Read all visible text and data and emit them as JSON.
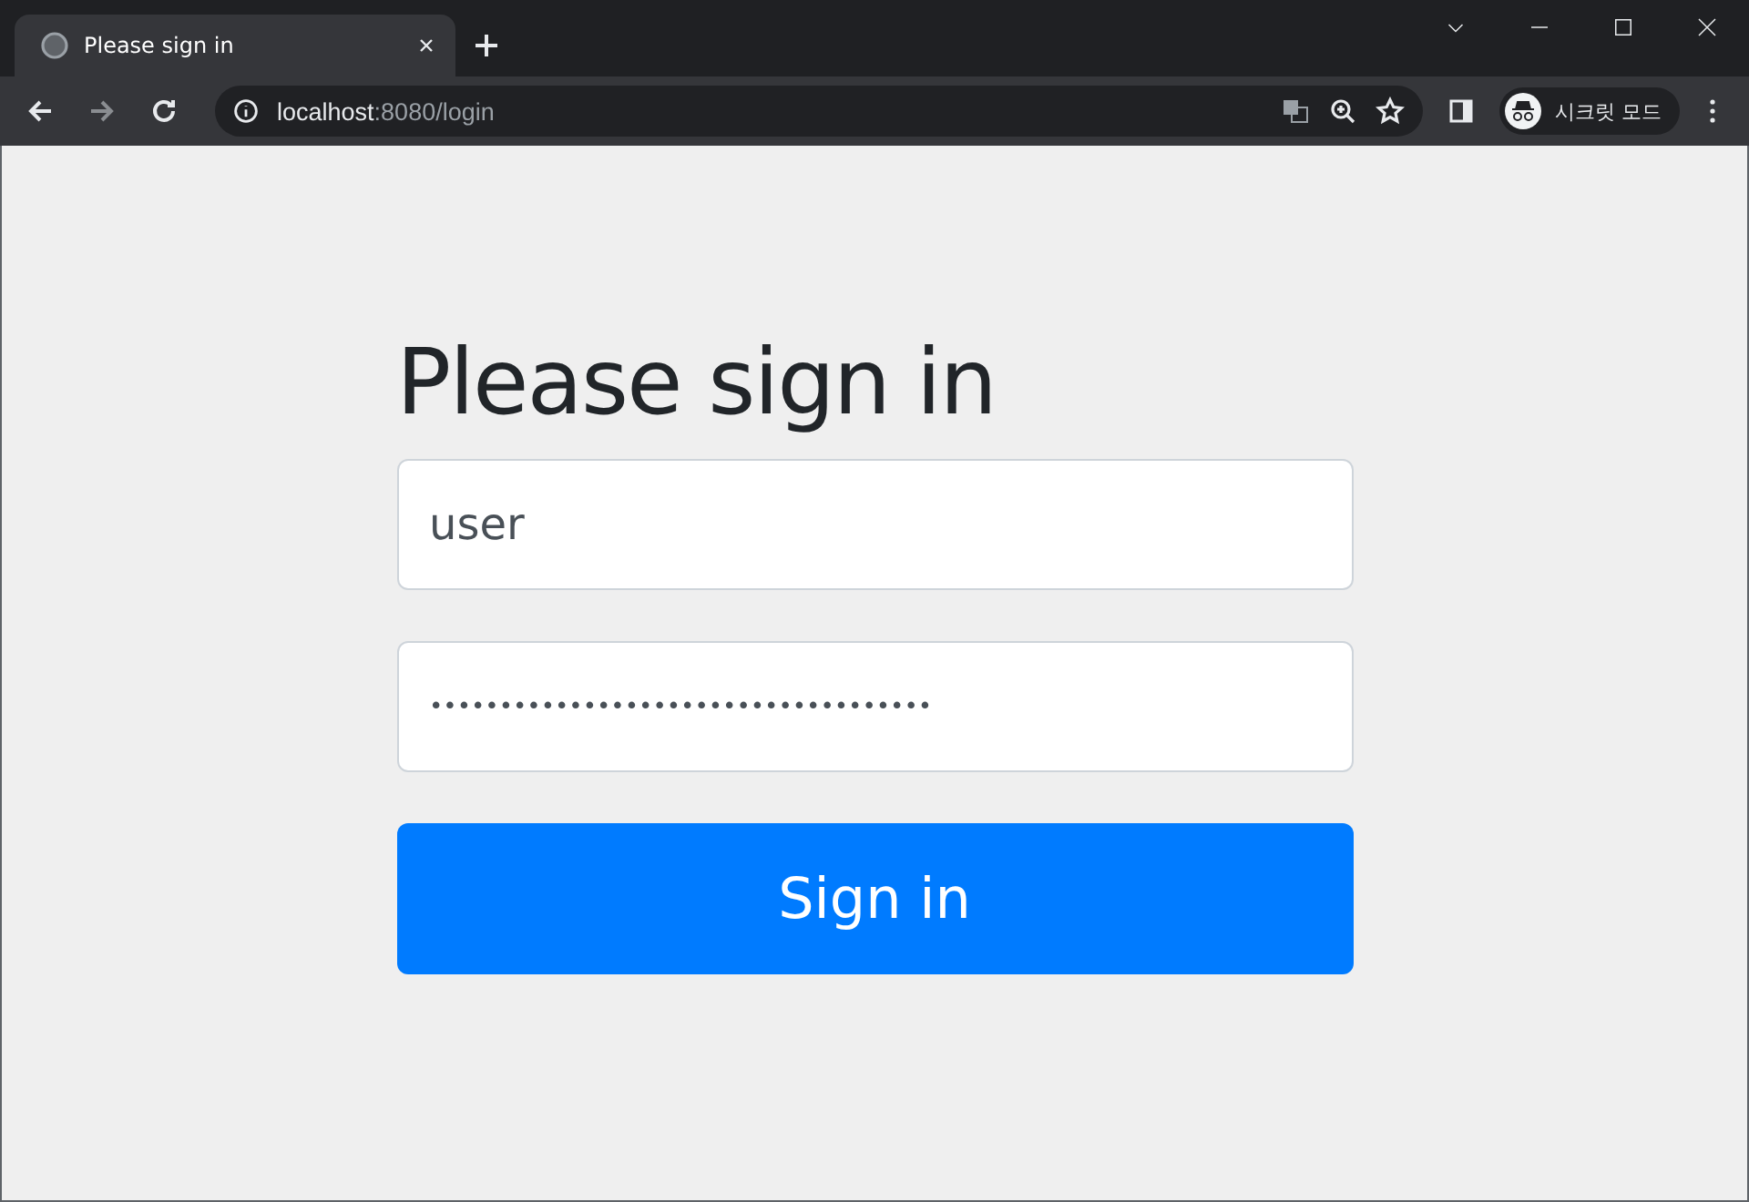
{
  "tab": {
    "title": "Please sign in",
    "selected": true
  },
  "address": {
    "host": "localhost",
    "path": ":8080/login"
  },
  "profile": {
    "label": "시크릿 모드"
  },
  "form": {
    "heading": "Please sign in",
    "username": {
      "value": "user"
    },
    "password": {
      "value": "••••••••••••••••••••••••••••••••••••"
    },
    "submit": "Sign in"
  }
}
